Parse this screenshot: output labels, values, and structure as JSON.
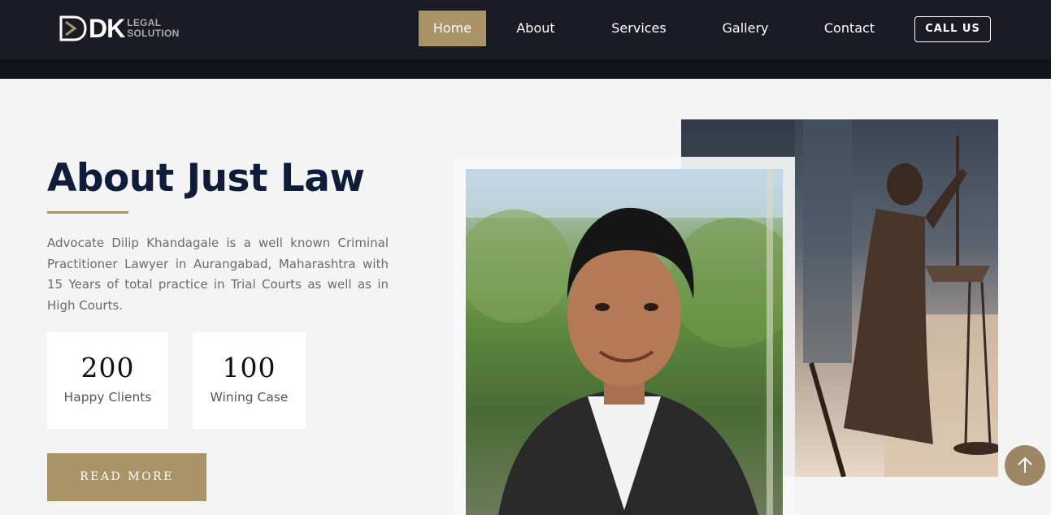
{
  "header": {
    "logo": {
      "mark": "DK",
      "line1": "LEGAL",
      "line2": "SOLUTION"
    },
    "nav": [
      {
        "label": "Home",
        "active": true
      },
      {
        "label": "About",
        "active": false
      },
      {
        "label": "Services",
        "active": false
      },
      {
        "label": "Gallery",
        "active": false
      },
      {
        "label": "Contact",
        "active": false
      }
    ],
    "call_label": "CALL US"
  },
  "about": {
    "title": "About Just Law",
    "description": "Advocate Dilip Khandagale is a well known Criminal Practitioner Lawyer in Aurangabad, Maharashtra with 15 Years of total practice in Trial Courts as well as in High Courts.",
    "stats": [
      {
        "value": "200",
        "label": "Happy Clients"
      },
      {
        "value": "100",
        "label": "Wining Case"
      }
    ],
    "read_more_label": "READ MORE"
  },
  "images": {
    "front": "advocate-portrait-photo",
    "back": "lady-justice-statue-photo"
  },
  "colors": {
    "accent": "#ab9368",
    "header_bg": "#1b1b26",
    "title": "#0f1d3a",
    "page_bg": "#f4f4f4"
  },
  "icons": {
    "scroll_top": "arrow-up-icon"
  }
}
